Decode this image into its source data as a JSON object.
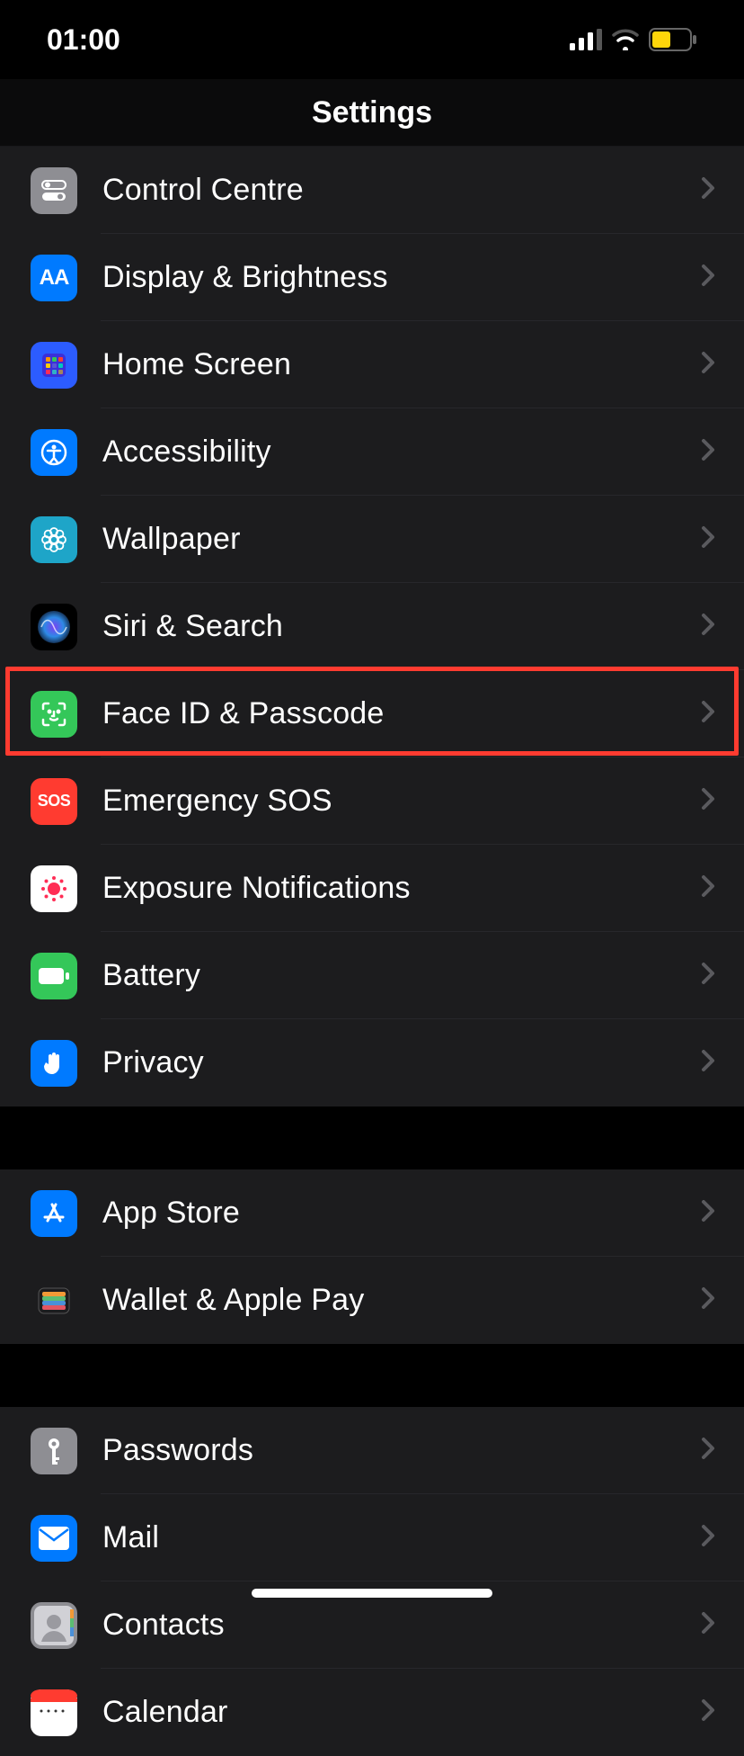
{
  "status": {
    "time": "01:00"
  },
  "title": "Settings",
  "highlight_index": 6,
  "sections": [
    {
      "rows": [
        {
          "id": "control-centre",
          "label": "Control Centre",
          "bg": "bg-grey",
          "glyph": "toggles"
        },
        {
          "id": "display",
          "label": "Display & Brightness",
          "bg": "bg-blue",
          "glyph": "aa"
        },
        {
          "id": "home-screen",
          "label": "Home Screen",
          "bg": "bg-indigo",
          "glyph": "grid"
        },
        {
          "id": "accessibility",
          "label": "Accessibility",
          "bg": "bg-blue",
          "glyph": "body"
        },
        {
          "id": "wallpaper",
          "label": "Wallpaper",
          "bg": "bg-cyan",
          "glyph": "flower"
        },
        {
          "id": "siri",
          "label": "Siri & Search",
          "bg": "bg-black",
          "glyph": "siri"
        },
        {
          "id": "faceid",
          "label": "Face ID & Passcode",
          "bg": "bg-green",
          "glyph": "face"
        },
        {
          "id": "sos",
          "label": "Emergency SOS",
          "bg": "bg-red",
          "glyph": "sos"
        },
        {
          "id": "exposure",
          "label": "Exposure Notifications",
          "bg": "bg-white",
          "glyph": "exposure"
        },
        {
          "id": "battery",
          "label": "Battery",
          "bg": "bg-green",
          "glyph": "battery"
        },
        {
          "id": "privacy",
          "label": "Privacy",
          "bg": "bg-blue",
          "glyph": "hand"
        }
      ]
    },
    {
      "rows": [
        {
          "id": "appstore",
          "label": "App Store",
          "bg": "bg-blue",
          "glyph": "appstore"
        },
        {
          "id": "wallet",
          "label": "Wallet & Apple Pay",
          "bg": "bg-dark",
          "glyph": "wallet"
        }
      ]
    },
    {
      "rows": [
        {
          "id": "passwords",
          "label": "Passwords",
          "bg": "bg-grey",
          "glyph": "key"
        },
        {
          "id": "mail",
          "label": "Mail",
          "bg": "bg-blue",
          "glyph": "mail"
        },
        {
          "id": "contacts",
          "label": "Contacts",
          "bg": "bg-tan",
          "glyph": "contact"
        },
        {
          "id": "calendar",
          "label": "Calendar",
          "bg": "bg-white",
          "glyph": "calendar"
        }
      ]
    }
  ]
}
